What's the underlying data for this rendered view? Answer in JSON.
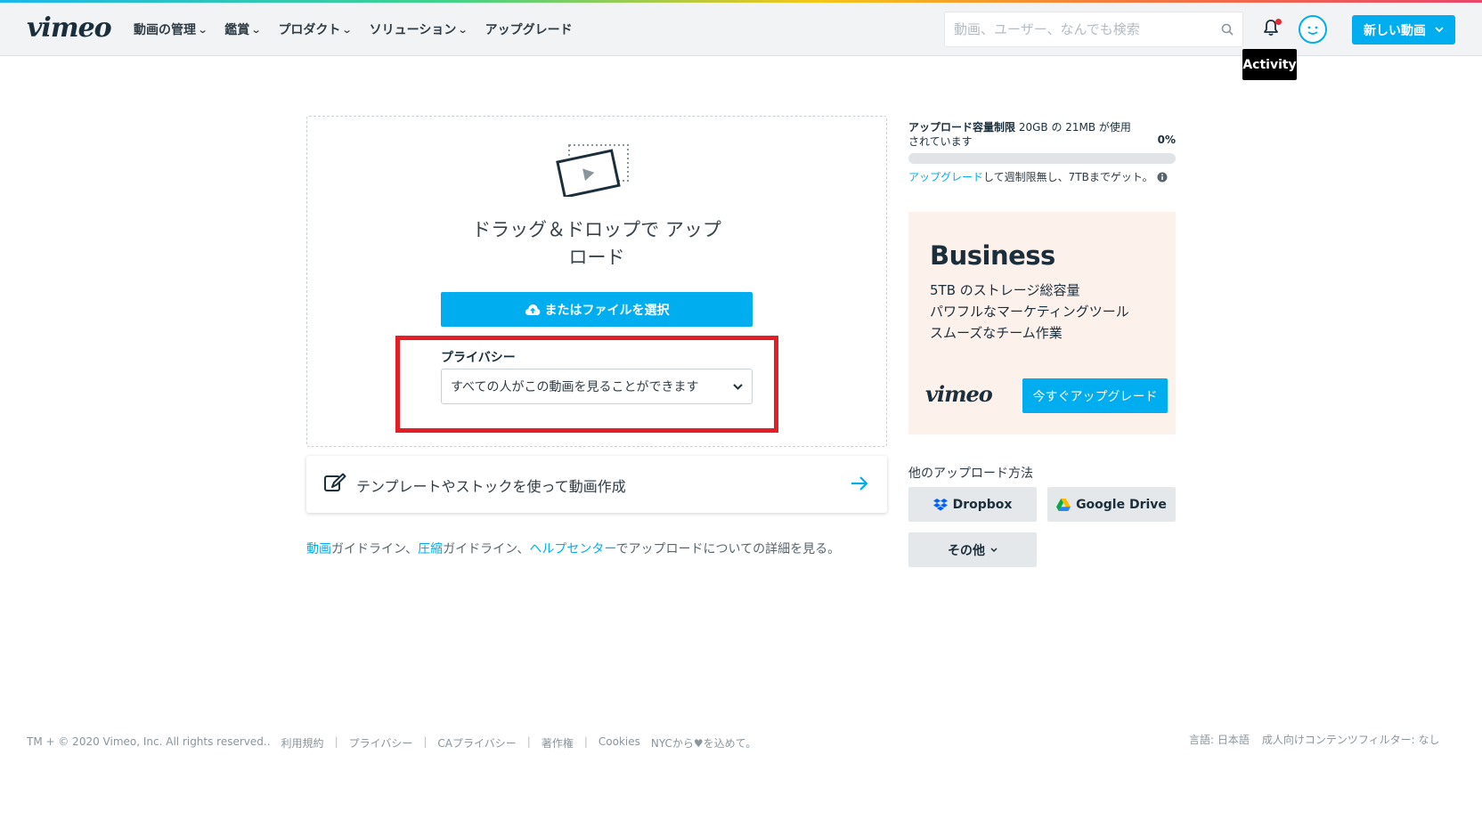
{
  "header": {
    "logo": "vimeo",
    "nav": [
      "動画の管理",
      "鑑賞",
      "プロダクト",
      "ソリューション",
      "アップグレード"
    ],
    "search_placeholder": "動画、ユーザー、なんでも検索",
    "tooltip": "Activity",
    "new_video": "新しい動画"
  },
  "upload": {
    "drop_line1": "ドラッグ＆ドロップで アップ",
    "drop_line2": "ロード",
    "choose_file": "またはファイルを選択",
    "privacy_label": "プライバシー",
    "privacy_value": "すべての人がこの動画を見ることができます"
  },
  "template_card": {
    "text": "テンプレートやストックを使って動画作成"
  },
  "guidelines": {
    "link1": "動画",
    "text1": "ガイドライン、",
    "link2": "圧縮",
    "text2": "ガイドライン、",
    "link3": "ヘルプセンター",
    "text3": "でアップロードについての詳細を見る。"
  },
  "quota": {
    "title": "アップロード容量制限",
    "detail": " 20GB の 21MB が使用",
    "line2": "されています",
    "percent": "0%",
    "fill_fraction": 0,
    "upgrade_link": "アップグレード",
    "upgrade_text": "して週制限無し、7TBまでゲット。"
  },
  "business": {
    "title": "Business",
    "features": [
      "5TB のストレージ総容量",
      "パワフルなマーケティングツール",
      "スムーズなチーム作業"
    ],
    "logo": "vimeo",
    "button": "今すぐアップグレード"
  },
  "other_methods": {
    "label": "他のアップロード方法",
    "dropbox": "Dropbox",
    "gdrive": "Google Drive",
    "more": "その他"
  },
  "footer": {
    "copyright": "TM + © 2020 Vimeo, Inc. All rights reserved..",
    "links": [
      "利用規約",
      "プライバシー",
      "CAプライバシー",
      "著作権",
      "Cookies"
    ],
    "nyc_before": "NYCから",
    "nyc_after": "を込めて。",
    "language": "言語: 日本語",
    "filter": "成人向けコンテンツフィルター: なし"
  },
  "colors": {
    "accent": "#00adef",
    "highlight": "#e41e26",
    "business_bg": "#fdf1ec"
  }
}
